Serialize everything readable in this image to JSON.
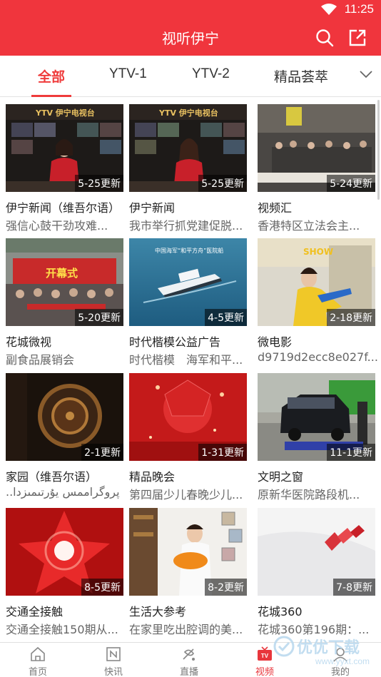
{
  "status_bar": {
    "time": "11:25"
  },
  "header": {
    "title": "视听伊宁",
    "search_icon": "search-icon",
    "share_icon": "share-icon"
  },
  "tabs": [
    {
      "label": "全部",
      "active": true
    },
    {
      "label": "YTV-1",
      "active": false
    },
    {
      "label": "YTV-2",
      "active": false
    },
    {
      "label": "精品荟萃",
      "active": false
    }
  ],
  "colors": {
    "brand": "#f0353d",
    "accent": "#ef3b3b"
  },
  "cards": [
    {
      "title": "伊宁新闻（维吾尔语）",
      "subtitle": "强信心鼓干劲攻难...",
      "badge": "5-25更新",
      "thumb_text": "YTV 伊宁电视台"
    },
    {
      "title": "伊宁新闻",
      "subtitle": "我市举行抓党建促脱...",
      "badge": "5-25更新",
      "thumb_text": "YTV 伊宁电视台"
    },
    {
      "title": "视频汇",
      "subtitle": "香港特区立法会主...",
      "badge": "5-24更新",
      "thumb_text": ""
    },
    {
      "title": "花城微视",
      "subtitle": "副食品展销会",
      "badge": "5-20更新",
      "thumb_text": "开幕式"
    },
    {
      "title": "时代楷模公益广告",
      "subtitle": "时代楷模　海军和平...",
      "badge": "4-5更新",
      "thumb_text": "中国海军“和平方舟”医院船"
    },
    {
      "title": "微电影",
      "subtitle": "d9719d2ecc8e027f...",
      "badge": "2-18更新",
      "thumb_text": "SHOW"
    },
    {
      "title": "家园（维吾尔语）",
      "subtitle": "..پروگراممس  يۇرتىمىزدا",
      "badge": "2-1更新",
      "thumb_text": ""
    },
    {
      "title": "精品晚会",
      "subtitle": "第四届少儿春晚少儿...",
      "badge": "1-31更新",
      "thumb_text": ""
    },
    {
      "title": "文明之窗",
      "subtitle": "原新华医院路段机...",
      "badge": "11-1更新",
      "thumb_text": ""
    },
    {
      "title": "交通全接触",
      "subtitle": "交通全接触150期从...",
      "badge": "8-5更新",
      "thumb_text": ""
    },
    {
      "title": "生活大参考",
      "subtitle": "在家里吃出腔调的美...",
      "badge": "8-2更新",
      "thumb_text": ""
    },
    {
      "title": "花城360",
      "subtitle": "花城360第196期：...",
      "badge": "7-8更新",
      "thumb_text": ""
    }
  ],
  "bottom_nav": [
    {
      "label": "首页",
      "icon": "home-icon",
      "active": false
    },
    {
      "label": "快讯",
      "icon": "news-icon",
      "active": false
    },
    {
      "label": "直播",
      "icon": "live-icon",
      "active": false
    },
    {
      "label": "视频",
      "icon": "tv-icon",
      "active": true
    },
    {
      "label": "我的",
      "icon": "profile-icon",
      "active": false
    }
  ],
  "watermark": {
    "text": "优优下载",
    "url": "www.yyxt.com"
  }
}
